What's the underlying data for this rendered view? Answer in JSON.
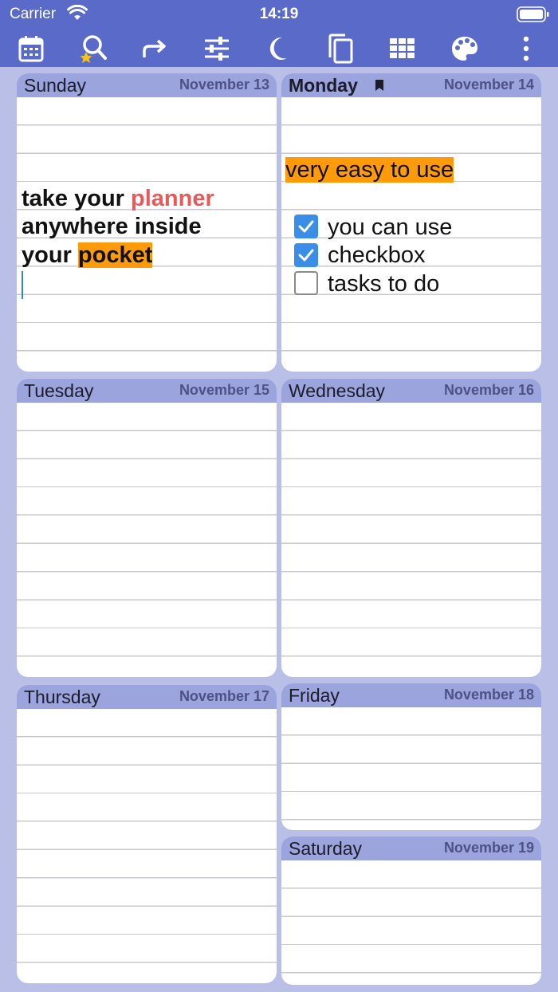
{
  "status": {
    "carrier": "Carrier",
    "time": "14:19"
  },
  "toolbar": {
    "icons": [
      "calendar-icon",
      "search-favorites-icon",
      "redo-icon",
      "sliders-icon",
      "moon-icon",
      "copy-icon",
      "grid-icon",
      "palette-icon",
      "more-vertical-icon"
    ]
  },
  "days": {
    "sunday": {
      "name": "Sunday",
      "date": "November 13"
    },
    "monday": {
      "name": "Monday",
      "date": "November 14"
    },
    "tuesday": {
      "name": "Tuesday",
      "date": "November 15"
    },
    "wednesday": {
      "name": "Wednesday",
      "date": "November 16"
    },
    "thursday": {
      "name": "Thursday",
      "date": "November 17"
    },
    "friday": {
      "name": "Friday",
      "date": "November 18"
    },
    "saturday": {
      "name": "Saturday",
      "date": "November 19"
    }
  },
  "sunday_note": {
    "line1a": "take your ",
    "line1b": "planner",
    "line2": "anywhere inside",
    "line3a": "your ",
    "line3b": "pocket"
  },
  "monday_note": {
    "highlight": "very easy to use",
    "tasks": [
      {
        "text": "you can use",
        "checked": true
      },
      {
        "text": "checkbox",
        "checked": true
      },
      {
        "text": "tasks to do",
        "checked": false
      }
    ]
  },
  "colors": {
    "header_bar": "#5a6ac9",
    "accent_orange": "#ff9a0b",
    "accent_red": "#e85a5a",
    "checkbox_blue": "#3b8ee8"
  }
}
